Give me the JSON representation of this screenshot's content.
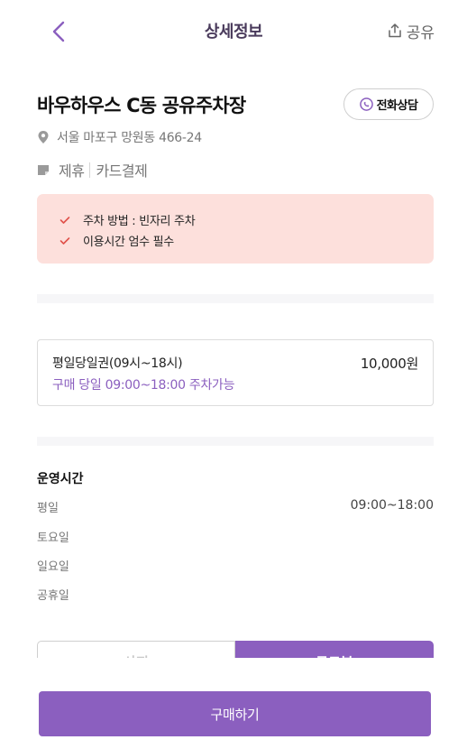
{
  "header": {
    "title": "상세정보",
    "share_label": "공유"
  },
  "place": {
    "name": "바우하우스 C동 공유주차장",
    "call_label": "전화상담",
    "address": "서울 마포구 망원동 466-24",
    "tags": [
      "제휴",
      "카드결제"
    ]
  },
  "notices": [
    "주차 방법 : 빈자리 주차",
    "이용시간 엄수 필수"
  ],
  "ticket": {
    "name": "평일당일권(09시~18시)",
    "price": "10,000원",
    "description": "구매 당일 09:00~18:00 주차가능"
  },
  "hours": {
    "title": "운영시간",
    "rows": [
      {
        "day": "평일",
        "time": "09:00~18:00"
      },
      {
        "day": "토요일",
        "time": ""
      },
      {
        "day": "일요일",
        "time": ""
      },
      {
        "day": "공휴일",
        "time": ""
      }
    ]
  },
  "tabs": {
    "left": "사진",
    "right": "로드뷰"
  },
  "buy_label": "구매하기",
  "colors": {
    "accent": "#8b5fbf",
    "notice_bg": "#fde0dc",
    "check": "#e0514a"
  }
}
